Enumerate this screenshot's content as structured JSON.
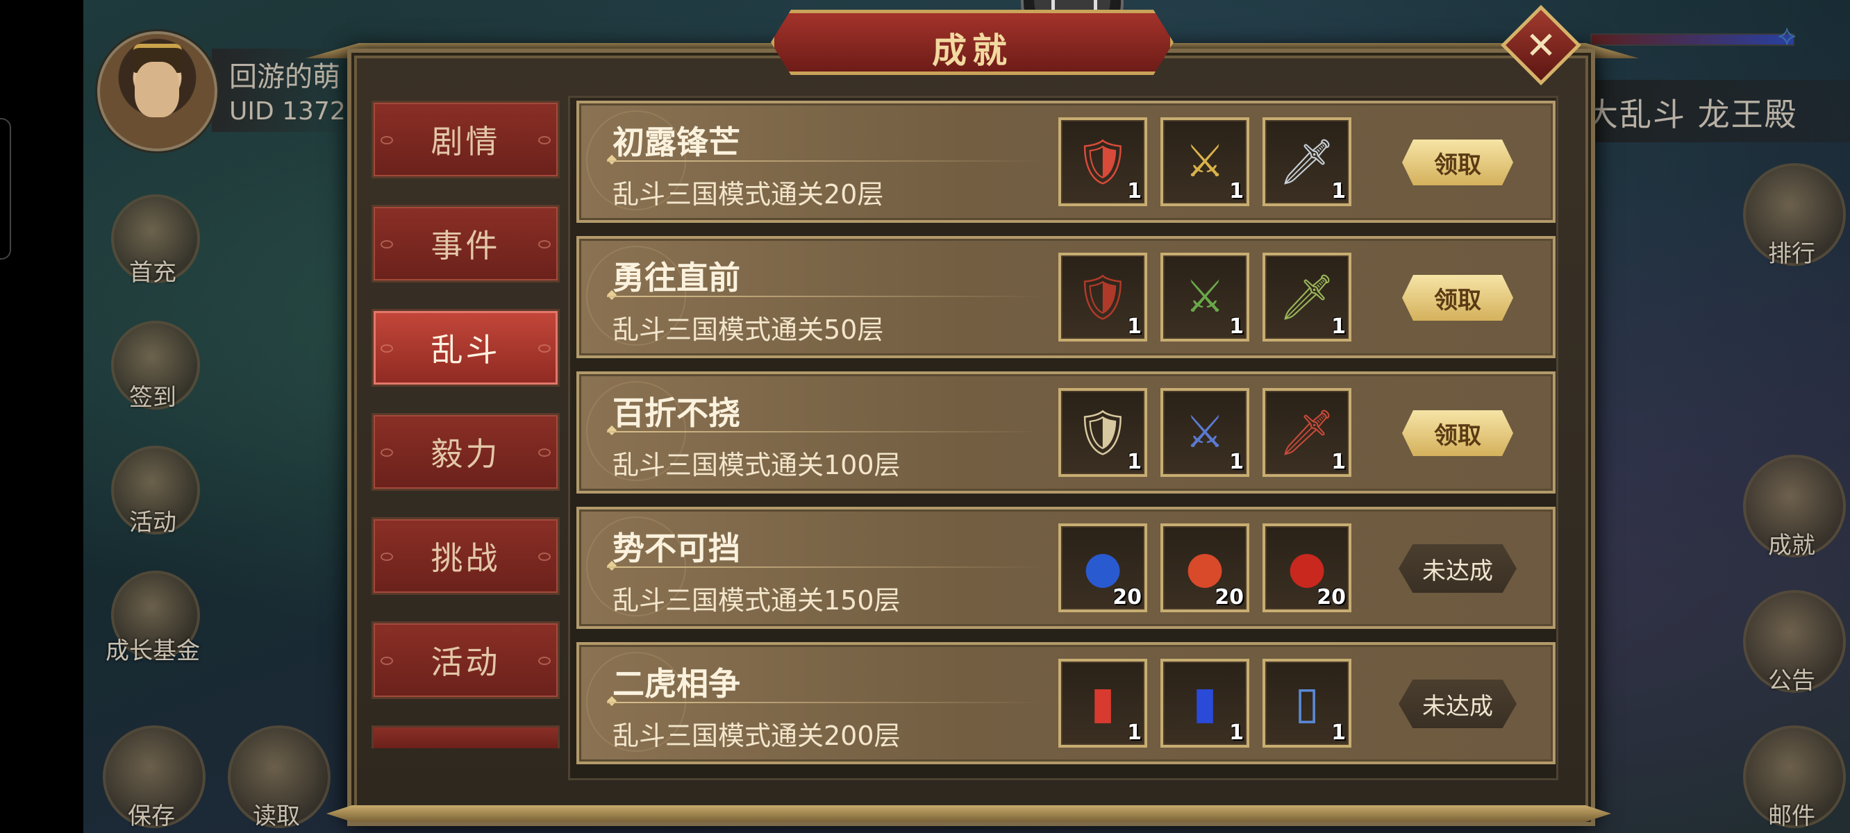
{
  "window": {
    "title": "成就"
  },
  "player": {
    "name": "回游的萌",
    "uid": "UID 1372"
  },
  "left_menu": [
    {
      "label": "首充",
      "icon": "first-charge-icon"
    },
    {
      "label": "签到",
      "icon": "sign-in-icon"
    },
    {
      "label": "活动",
      "icon": "event-icon"
    },
    {
      "label": "成长基金",
      "icon": "growth-fund-icon"
    },
    {
      "label": "保存",
      "icon": "save-icon"
    },
    {
      "label": "读取",
      "icon": "load-icon"
    }
  ],
  "right_menu": [
    {
      "label": "排行",
      "icon": "ranking-icon"
    },
    {
      "label": "成就",
      "icon": "achievement-icon"
    },
    {
      "label": "公告",
      "icon": "notice-icon"
    },
    {
      "label": "邮件",
      "icon": "mail-icon"
    }
  ],
  "banner_right": "大乱斗 龙王殿",
  "tabs": [
    {
      "label": "剧情",
      "active": false
    },
    {
      "label": "事件",
      "active": false
    },
    {
      "label": "乱斗",
      "active": true
    },
    {
      "label": "毅力",
      "active": false
    },
    {
      "label": "挑战",
      "active": false
    },
    {
      "label": "活动",
      "active": false
    }
  ],
  "achievements": [
    {
      "name": "初露锋芒",
      "desc": "乱斗三国模式通关20层",
      "rewards": [
        {
          "icon": "armor-red-icon",
          "qty": "1"
        },
        {
          "icon": "armor-gold-icon",
          "qty": "1"
        },
        {
          "icon": "sword-icon",
          "qty": "1"
        }
      ],
      "status": "claim",
      "button": "领取"
    },
    {
      "name": "勇往直前",
      "desc": "乱斗三国模式通关50层",
      "rewards": [
        {
          "icon": "armor-dark-icon",
          "qty": "1"
        },
        {
          "icon": "general-green-icon",
          "qty": "1"
        },
        {
          "icon": "glaive-icon",
          "qty": "1"
        }
      ],
      "status": "claim",
      "button": "领取"
    },
    {
      "name": "百折不挠",
      "desc": "乱斗三国模式通关100层",
      "rewards": [
        {
          "icon": "armor-silver-icon",
          "qty": "1"
        },
        {
          "icon": "general-blue-icon",
          "qty": "1"
        },
        {
          "icon": "spear-icon",
          "qty": "1"
        }
      ],
      "status": "claim",
      "button": "领取"
    },
    {
      "name": "势不可挡",
      "desc": "乱斗三国模式通关150层",
      "rewards": [
        {
          "icon": "blue-fruit-icon",
          "qty": "20"
        },
        {
          "icon": "red-fruit-icon",
          "qty": "20"
        },
        {
          "icon": "red-pouch-icon",
          "qty": "20"
        }
      ],
      "status": "pending",
      "button": "未达成"
    },
    {
      "name": "二虎相争",
      "desc": "乱斗三国模式通关200层",
      "rewards": [
        {
          "icon": "red-book-icon",
          "qty": "1"
        },
        {
          "icon": "blue-book-icon",
          "qty": "1"
        },
        {
          "icon": "scroll-icon",
          "qty": "1"
        }
      ],
      "status": "pending",
      "button": "未达成"
    }
  ],
  "close_symbol": "✕"
}
